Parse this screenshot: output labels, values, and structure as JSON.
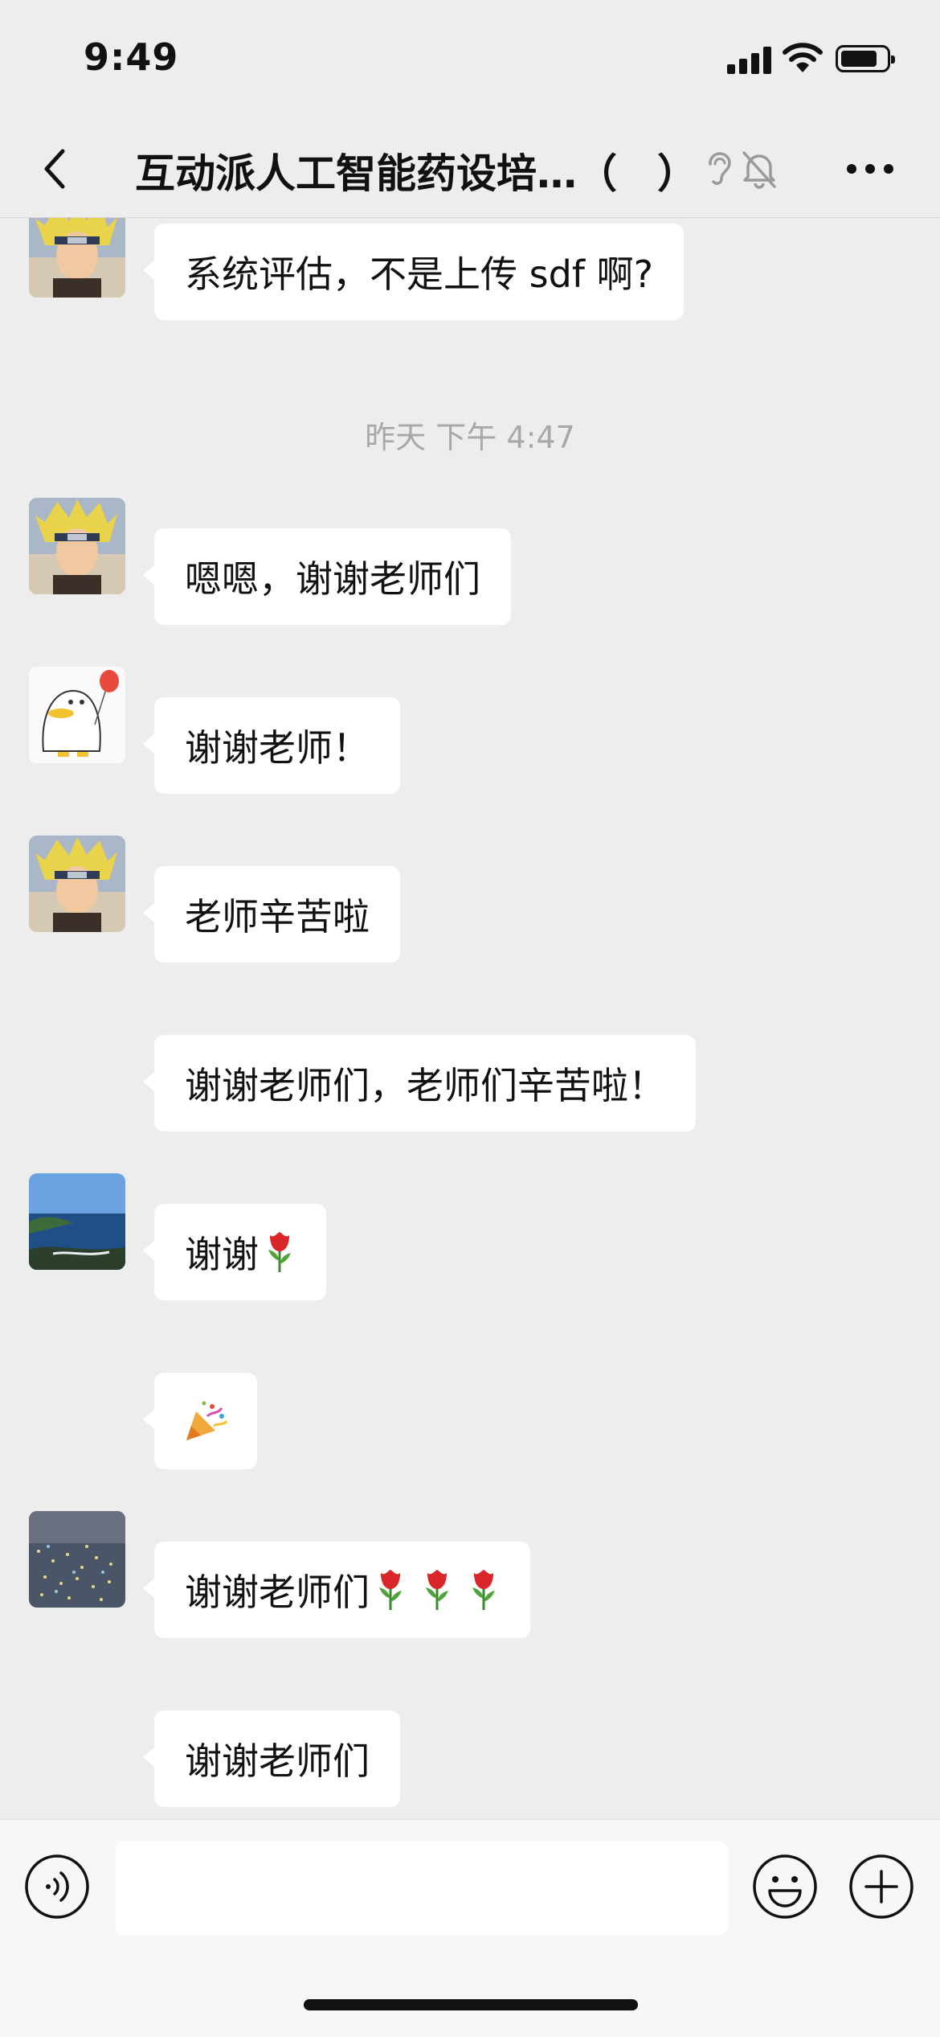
{
  "status_bar": {
    "time": "9:49"
  },
  "header": {
    "title": "互动派人工智能药设培…（　）"
  },
  "messages": [
    {
      "type": "text",
      "avatar": "naruto-avatar",
      "text": "系统评估，不是上传 sdf 啊?"
    },
    {
      "type": "time",
      "text": "昨天 下午 4:47"
    },
    {
      "type": "text",
      "avatar": "naruto-avatar",
      "text": "嗯嗯，谢谢老师们"
    },
    {
      "type": "text",
      "avatar": "duck-balloon-avatar",
      "text": "谢谢老师！"
    },
    {
      "type": "text",
      "avatar": "naruto-avatar",
      "text": "老师辛苦啦"
    },
    {
      "type": "text",
      "avatar": "none",
      "text": "谢谢老师们，老师们辛苦啦！"
    },
    {
      "type": "text",
      "avatar": "seascape-avatar",
      "text": "谢谢",
      "emojis": [
        "rose-icon"
      ]
    },
    {
      "type": "emoji",
      "avatar": "none",
      "emojis": [
        "party-popper-icon"
      ]
    },
    {
      "type": "text",
      "avatar": "city-lights-avatar",
      "text": "谢谢老师们",
      "emojis": [
        "rose-icon",
        "rose-icon",
        "rose-icon"
      ]
    },
    {
      "type": "text",
      "avatar": "none",
      "text": "谢谢老师们"
    }
  ],
  "input": {
    "value": ""
  },
  "colors": {
    "background": "#ededed",
    "bubble": "#ffffff",
    "timestamp": "#a8a8a8",
    "input_bar": "#f7f7f7"
  }
}
